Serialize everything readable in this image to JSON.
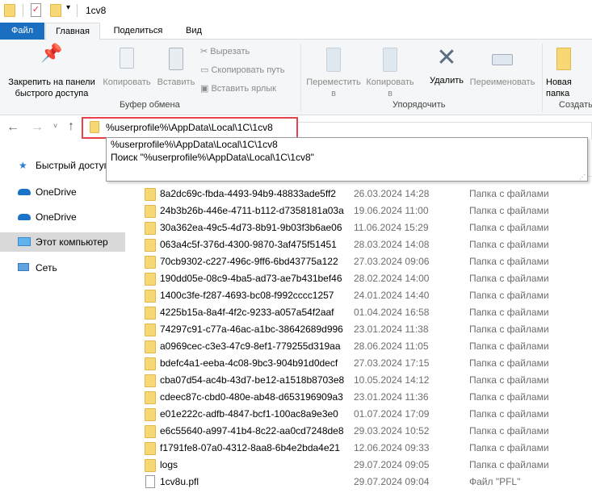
{
  "window": {
    "title": "1cv8"
  },
  "tabs": [
    {
      "label": "Файл"
    },
    {
      "label": "Главная"
    },
    {
      "label": "Поделиться"
    },
    {
      "label": "Вид"
    }
  ],
  "ribbon": {
    "pin": "Закрепить на панели быстрого доступа",
    "copy": "Копировать",
    "paste": "Вставить",
    "cut": "Вырезать",
    "copy_path": "Скопировать путь",
    "paste_shortcut": "Вставить ярлык",
    "clipboard_group": "Буфер обмена",
    "move_to": "Переместить в",
    "copy_to": "Копировать в",
    "delete": "Удалить",
    "rename": "Переименовать",
    "organize_group": "Упорядочить",
    "new_folder": "Новая папка",
    "create_group": "Создать"
  },
  "address": {
    "value": "%userprofile%\\AppData\\Local\\1C\\1cv8",
    "suggestions": [
      "%userprofile%\\AppData\\Local\\1C\\1cv8",
      "Поиск \"%userprofile%\\AppData\\Local\\1C\\1cv8\""
    ]
  },
  "sidebar": {
    "items": [
      {
        "label": "Быстрый доступ",
        "icon": "star-icon"
      },
      {
        "label": "OneDrive",
        "icon": "cloud-icon"
      },
      {
        "label": "OneDrive",
        "icon": "cloud-icon"
      },
      {
        "label": "Этот компьютер",
        "icon": "computer-icon",
        "selected": true
      },
      {
        "label": "Сеть",
        "icon": "network-icon"
      }
    ]
  },
  "files": [
    {
      "name": "8a2dc69c-fbda-4493-94b9-48833ade5ff2",
      "date": "26.03.2024 14:28",
      "type": "Папка с файлами"
    },
    {
      "name": "24b3b26b-446e-4711-b112-d7358181a03a",
      "date": "19.06.2024 11:00",
      "type": "Папка с файлами"
    },
    {
      "name": "30a362ea-49c5-4d73-8b91-9b03f3b6ae06",
      "date": "11.06.2024 15:29",
      "type": "Папка с файлами"
    },
    {
      "name": "063a4c5f-376d-4300-9870-3af475f51451",
      "date": "28.03.2024 14:08",
      "type": "Папка с файлами"
    },
    {
      "name": "70cb9302-c227-496c-9ff6-6bd43775a122",
      "date": "27.03.2024 09:06",
      "type": "Папка с файлами"
    },
    {
      "name": "190dd05e-08c9-4ba5-ad73-ae7b431bef46",
      "date": "28.02.2024 14:00",
      "type": "Папка с файлами"
    },
    {
      "name": "1400c3fe-f287-4693-bc08-f992cccc1257",
      "date": "24.01.2024 14:40",
      "type": "Папка с файлами"
    },
    {
      "name": "4225b15a-8a4f-4f2c-9233-a057a54f2aaf",
      "date": "01.04.2024 16:58",
      "type": "Папка с файлами"
    },
    {
      "name": "74297c91-c77a-46ac-a1bc-38642689d996",
      "date": "23.01.2024 11:38",
      "type": "Папка с файлами"
    },
    {
      "name": "a0969cec-c3e3-47c9-8ef1-779255d319aa",
      "date": "28.06.2024 11:05",
      "type": "Папка с файлами"
    },
    {
      "name": "bdefc4a1-eeba-4c08-9bc3-904b91d0decf",
      "date": "27.03.2024 17:15",
      "type": "Папка с файлами"
    },
    {
      "name": "cba07d54-ac4b-43d7-be12-a1518b8703e8",
      "date": "10.05.2024 14:12",
      "type": "Папка с файлами"
    },
    {
      "name": "cdeec87c-cbd0-480e-ab48-d653196909a3",
      "date": "23.01.2024 11:36",
      "type": "Папка с файлами"
    },
    {
      "name": "e01e222c-adfb-4847-bcf1-100ac8a9e3e0",
      "date": "01.07.2024 17:09",
      "type": "Папка с файлами"
    },
    {
      "name": "e6c55640-a997-41b4-8c22-aa0cd7248de8",
      "date": "29.03.2024 10:52",
      "type": "Папка с файлами"
    },
    {
      "name": "f1791fe8-07a0-4312-8aa8-6b4e2bda4e21",
      "date": "12.06.2024 09:33",
      "type": "Папка с файлами"
    },
    {
      "name": "logs",
      "date": "29.07.2024 09:05",
      "type": "Папка с файлами"
    },
    {
      "name": "1cv8u.pfl",
      "date": "29.07.2024 09:04",
      "type": "Файл \"PFL\"",
      "file": true
    }
  ],
  "colors": {
    "file_tab": "#1a6fc1",
    "highlight": "#e8414b",
    "selected": "#d9d9d9"
  }
}
